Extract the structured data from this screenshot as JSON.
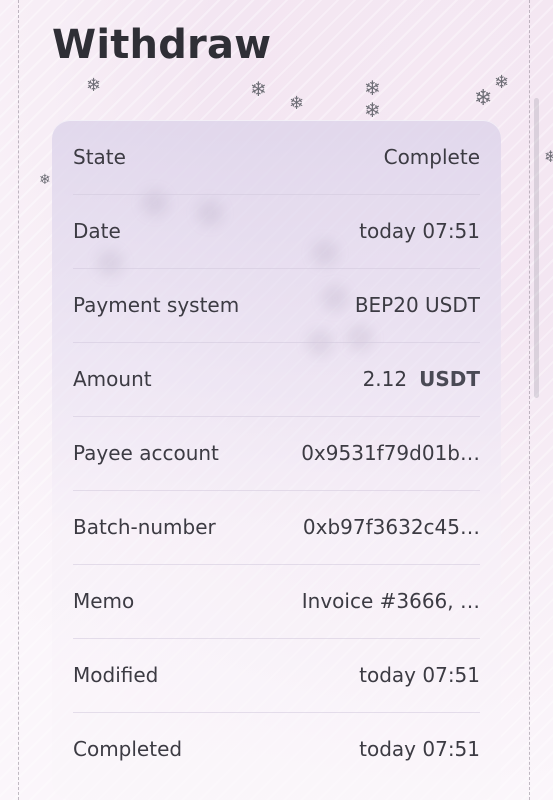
{
  "page": {
    "title": "Withdraw"
  },
  "details": {
    "rows": [
      {
        "label": "State",
        "value": "Complete"
      },
      {
        "label": "Date",
        "value": "today 07:51"
      },
      {
        "label": "Payment system",
        "value": "BEP20 USDT"
      },
      {
        "label": "Amount",
        "value": "2.12",
        "unit": "USDT"
      },
      {
        "label": "Payee account",
        "value": "0x9531f79d01b…"
      },
      {
        "label": "Batch-number",
        "value": "0xb97f3632c45…"
      },
      {
        "label": "Memo",
        "value": "Invoice #3666, …"
      },
      {
        "label": "Modified",
        "value": "today 07:51"
      },
      {
        "label": "Completed",
        "value": "today 07:51"
      }
    ]
  },
  "decorations": {
    "snowflake_icon": "snowflake-icon",
    "snowflake_glyph": "❄"
  },
  "colors": {
    "background_tint": "#f3e6f2",
    "card_tint": "#ded5eb",
    "text": "#3c3b43",
    "title": "#2f2f36"
  }
}
